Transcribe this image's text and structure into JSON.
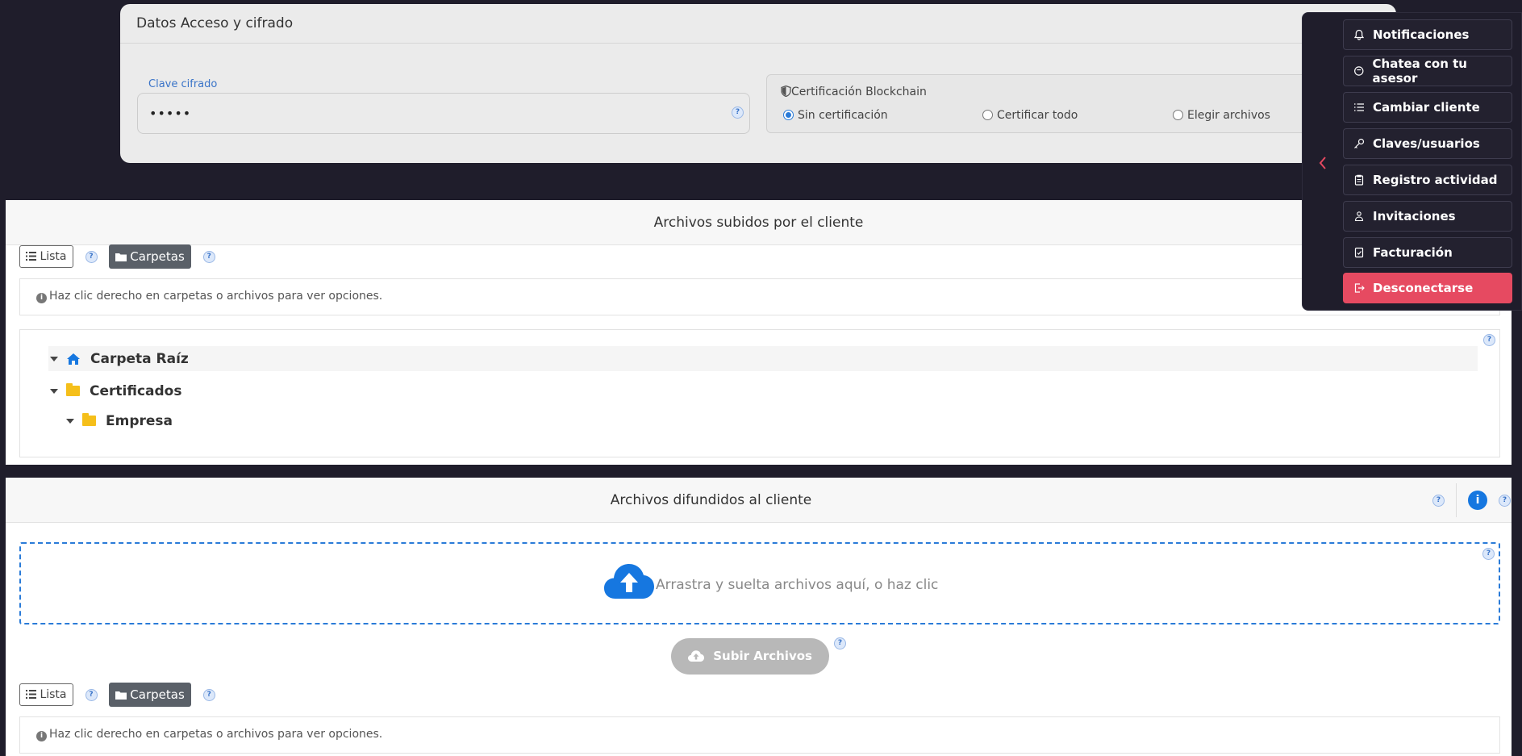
{
  "access_card": {
    "title": "Datos Acceso y cifrado",
    "field_label": "Clave cifrado",
    "field_value": "•••••",
    "cert_title": "Certificación Blockchain",
    "radios": [
      "Sin certificación",
      "Certificar todo",
      "Elegir archivos"
    ],
    "selected_radio": "Sin certificación"
  },
  "uploaded_panel": {
    "title": "Archivos subidos por el cliente",
    "lista_label": "Lista",
    "carpetas_label": "Carpetas",
    "info_text": "Haz clic derecho en carpetas o archivos para ver opciones.",
    "tree": [
      {
        "label": "Carpeta Raíz",
        "icon": "home-icon"
      },
      {
        "label": "Certificados",
        "icon": "folder-icon"
      },
      {
        "label": "Empresa",
        "icon": "folder-icon"
      }
    ]
  },
  "shared_panel": {
    "title": "Archivos difundidos al cliente",
    "drop_text": "Arrastra y suelta archivos aquí, o haz clic",
    "upload_label": "Subir Archivos",
    "lista_label": "Lista",
    "carpetas_label": "Carpetas",
    "info_text": "Haz clic derecho en carpetas o archivos para ver opciones."
  },
  "side_menu": {
    "items": [
      {
        "label": "Notificaciones",
        "icon": "bell-icon"
      },
      {
        "label": "Chatea con tu asesor",
        "icon": "chat-icon"
      },
      {
        "label": "Cambiar cliente",
        "icon": "list-icon"
      },
      {
        "label": "Claves/usuarios",
        "icon": "key-icon"
      },
      {
        "label": "Registro actividad",
        "icon": "clipboard-icon"
      },
      {
        "label": "Invitaciones",
        "icon": "users-icon"
      },
      {
        "label": "Facturación",
        "icon": "invoice-icon"
      },
      {
        "label": "Desconectarse",
        "icon": "logout-icon"
      }
    ]
  },
  "help_symbol": "?",
  "info_symbol": "i",
  "colors": {
    "accent": "#2a7bd8",
    "danger": "#e64a61",
    "folder": "#f5bf1a",
    "dark_bg": "#1f1d2b"
  }
}
